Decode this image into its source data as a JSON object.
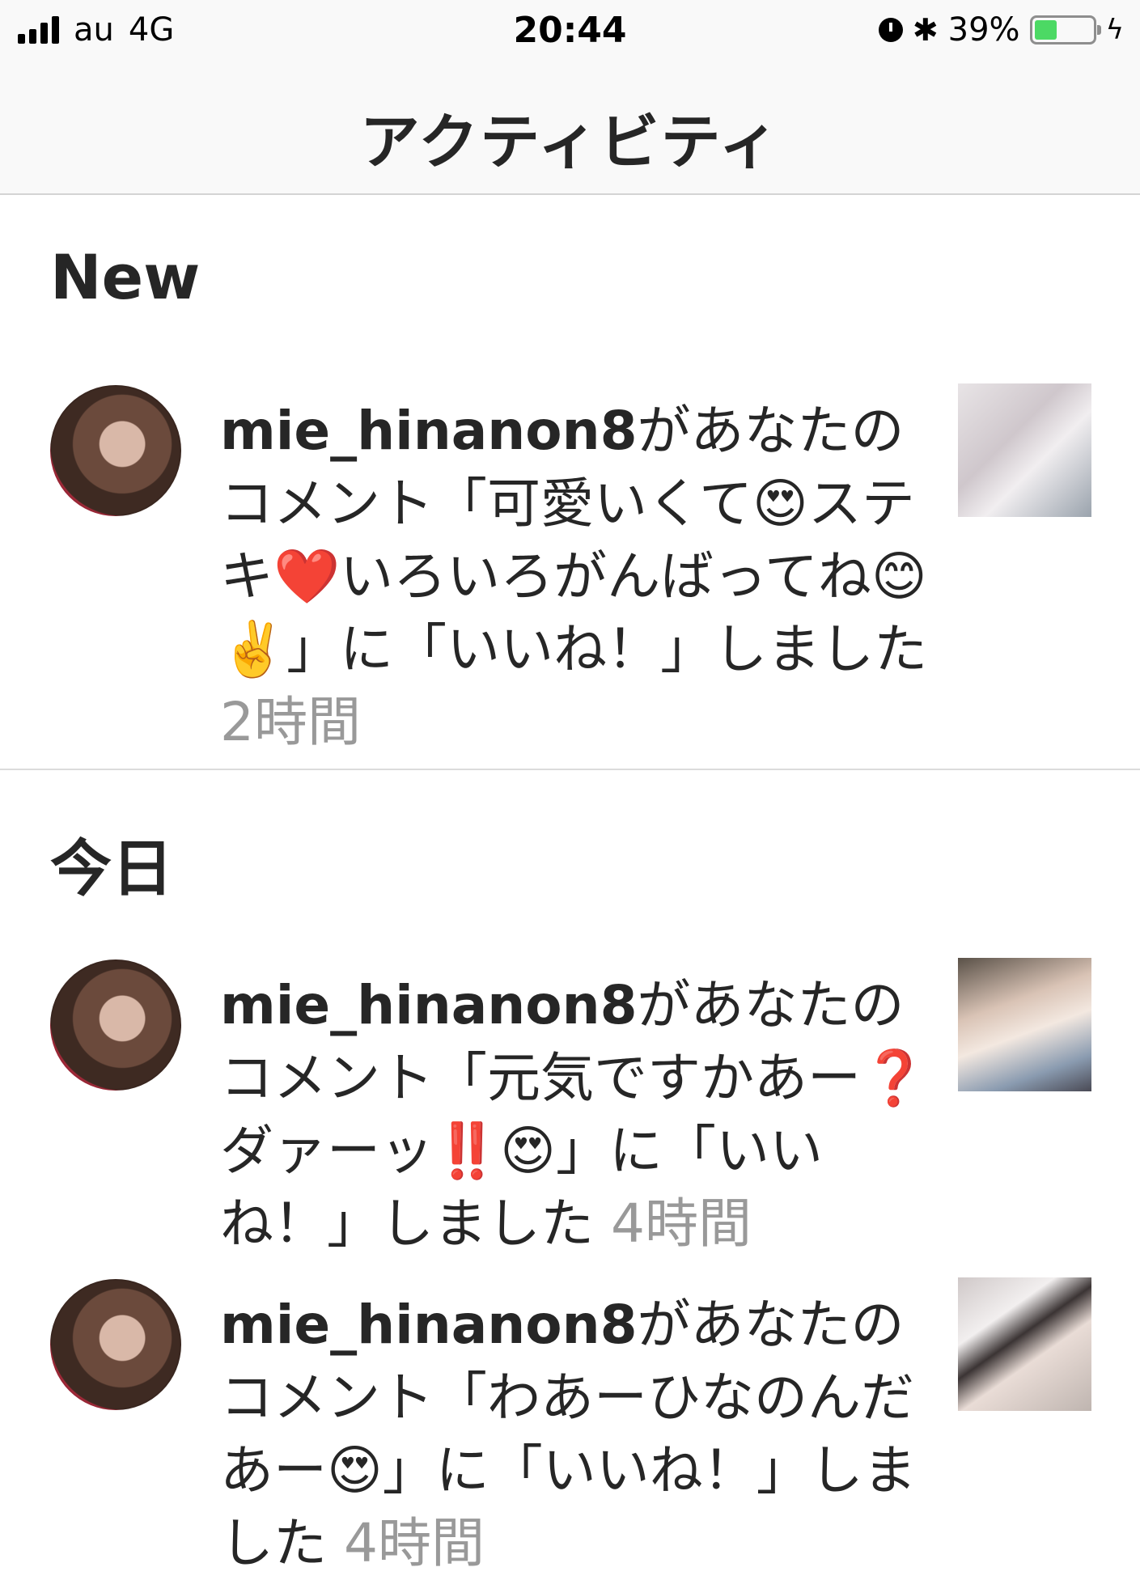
{
  "status_bar": {
    "carrier": "au",
    "network": "4G",
    "time": "20:44",
    "bluetooth_glyph": "✱",
    "battery_percent": "39%",
    "battery_level": 0.39,
    "battery_color": "#4cd964",
    "icons": [
      "signal-icon",
      "alarm-icon",
      "bluetooth-icon",
      "battery-icon",
      "charging-icon"
    ]
  },
  "nav": {
    "title": "アクティビティ"
  },
  "sections": {
    "new": {
      "header": "New"
    },
    "today": {
      "header": "今日"
    }
  },
  "activities": [
    {
      "username": "mie_hinanon8",
      "text": "があなたのコメント「可愛いくて😍ステキ❤️いろいろがんばってね😊✌️」に「いいね！」しました",
      "time": "2時間"
    },
    {
      "username": "mie_hinanon8",
      "text": "があなたのコメント「元気ですかあー❓ダァーッ‼️😍」に「いいね！」しました",
      "time": "4時間"
    },
    {
      "username": "mie_hinanon8",
      "text": "があなたのコメント「わあーひなのんだあー😍」に「いいね！」しました",
      "time": "4時間"
    }
  ]
}
